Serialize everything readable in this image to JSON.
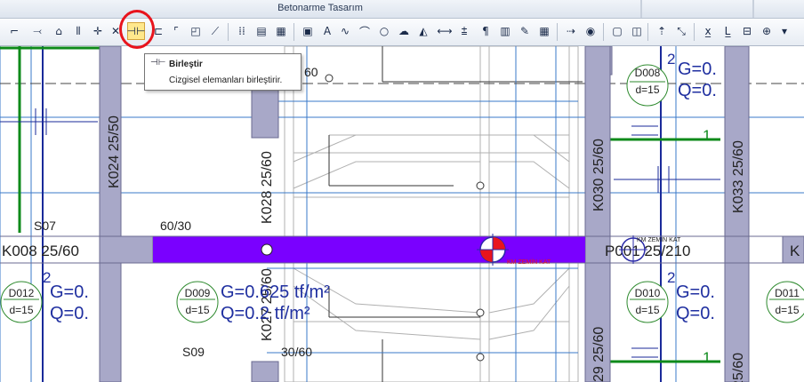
{
  "window": {
    "title": "Betonarme Tasarım"
  },
  "toolbar": {
    "icons": [
      "polyline-icon",
      "line-tool-icon",
      "roof-icon",
      "wall-mirror-icon",
      "cross-snap-icon",
      "diagonal-cross-icon",
      "merge-icon",
      "extend-icon",
      "corner-icon",
      "rect-frame-icon",
      "wand-icon",
      "grid-dots-icon",
      "calculator-icon",
      "grid-table-icon",
      "image-icon",
      "text-icon",
      "spline-icon",
      "arc-icon",
      "circle-icon",
      "cloud-icon",
      "hatch-icon",
      "dimension-icon",
      "leveling-icon",
      "paragraph-icon",
      "chart-icon",
      "pen-icon",
      "table-icon",
      "arrow-level-icon",
      "eye-icon",
      "window-frame-icon",
      "window-split-icon",
      "move-up-icon",
      "scale-icon",
      "xyz-icon",
      "lz-icon",
      "section-icon",
      "target-icon",
      "toolbar-more-icon"
    ],
    "text_glyph": "A",
    "highlighted": "merge-icon"
  },
  "tooltip": {
    "title": "Birleştir",
    "description": "Cizgisel elemanları birleştirir."
  },
  "drawing": {
    "columns": [
      {
        "label": "K024 25/50"
      },
      {
        "label": "K028 25/60"
      },
      {
        "label": "K030 25/60"
      },
      {
        "label": "K033 25/60"
      },
      {
        "label": "K027 25/60"
      },
      {
        "label": "29 25/60"
      },
      {
        "label": "25/60"
      }
    ],
    "beams": [
      {
        "label": "K008 25/60"
      },
      {
        "label": "P001 25/210"
      },
      {
        "label": "K"
      }
    ],
    "slabs": [
      {
        "id": "D008",
        "thickness": "d=15"
      },
      {
        "id": "D012",
        "thickness": "d=15"
      },
      {
        "id": "D009",
        "thickness": "d=15"
      },
      {
        "id": "D010",
        "thickness": "d=15"
      },
      {
        "id": "D011",
        "thickness": "d=15"
      }
    ],
    "loads": [
      {
        "g": "G=0.",
        "q": "Q=0."
      },
      {
        "g": "G=0.",
        "q": "Q=0."
      },
      {
        "g": "G=0.625 tf/m²",
        "q": "Q=0.2 tf/m²"
      },
      {
        "g": "G=0.",
        "q": "Q=0."
      }
    ],
    "labels": {
      "s07": "S07",
      "s09": "S09",
      "d6030a": "60/30",
      "d3060": "30/60",
      "d60": "60",
      "two_top": "2",
      "two_left": "2",
      "two_mid": "2",
      "one_top": "1",
      "one_bottom": "1",
      "kmzemin": "KM ZEMİN KAT",
      "kmzemin_red": "KM ZEMİN KAT"
    },
    "colors": {
      "grid": "#3a78c8",
      "column_fill": "#a8a8c8",
      "beam_purple": "#7a00ff",
      "slab_green": "#2e8a2e",
      "line_navy": "#1a2a9a",
      "label_blue": "#1f2fa0",
      "green_line": "#0d8a1a",
      "red": "#e8141d"
    }
  }
}
